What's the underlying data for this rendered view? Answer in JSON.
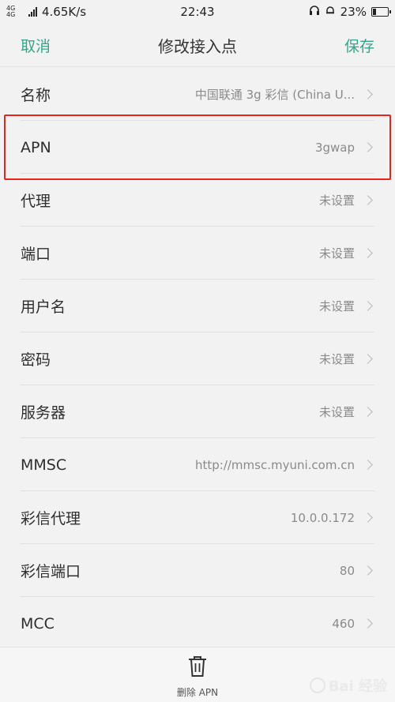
{
  "status_bar": {
    "network": "4G 4G",
    "speed": "4.65K/s",
    "time": "22:43",
    "battery_percent": "23%",
    "battery_level": 0.23
  },
  "header": {
    "cancel_label": "取消",
    "title": "修改接入点",
    "save_label": "保存"
  },
  "fields": [
    {
      "label": "名称",
      "value": "中国联通 3g 彩信 (China U..."
    },
    {
      "label": "APN",
      "value": "3gwap"
    },
    {
      "label": "代理",
      "value": "未设置"
    },
    {
      "label": "端口",
      "value": "未设置"
    },
    {
      "label": "用户名",
      "value": "未设置"
    },
    {
      "label": "密码",
      "value": "未设置"
    },
    {
      "label": "服务器",
      "value": "未设置"
    },
    {
      "label": "MMSC",
      "value": "http://mmsc.myuni.com.cn"
    },
    {
      "label": "彩信代理",
      "value": "10.0.0.172"
    },
    {
      "label": "彩信端口",
      "value": "80"
    },
    {
      "label": "MCC",
      "value": "460"
    }
  ],
  "bottom_bar": {
    "delete_label": "删除 APN"
  },
  "watermark": {
    "text": "Bai 经验"
  },
  "colors": {
    "accent": "#35a589",
    "highlight": "#e8241c"
  }
}
